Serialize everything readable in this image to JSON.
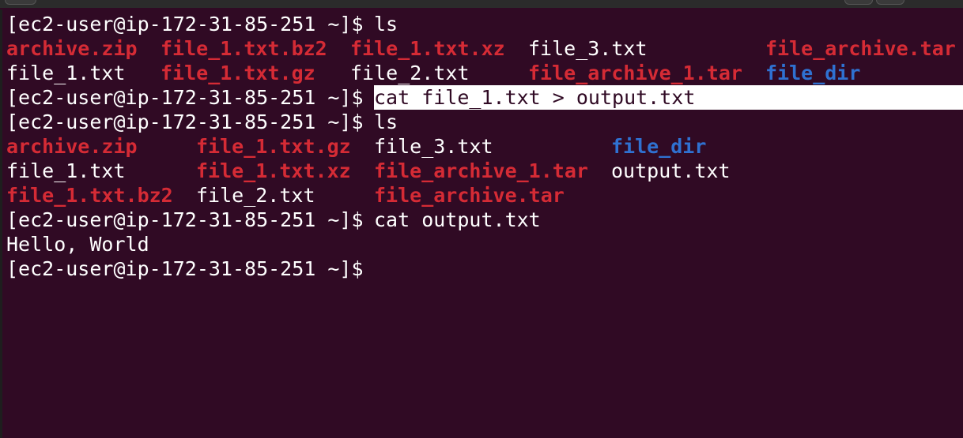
{
  "terminal": {
    "prompt": "[ec2-user@ip-172-31-85-251 ~]$",
    "commands": {
      "ls_1": "ls",
      "cat_redirect": "cat file_1.txt > output.txt",
      "ls_2": "ls",
      "cat_output": "cat output.txt"
    },
    "ls_1_output": {
      "row1": [
        "archive.zip",
        "file_1.txt.bz2",
        "file_1.txt.xz",
        "file_3.txt",
        "file_archive.tar"
      ],
      "row2": [
        "file_1.txt",
        "file_1.txt.gz",
        "file_2.txt",
        "file_archive_1.tar",
        "file_dir"
      ]
    },
    "ls_2_output": {
      "row1": [
        "archive.zip",
        "file_1.txt.gz",
        "file_3.txt",
        "file_dir"
      ],
      "row2": [
        "file_1.txt",
        "file_1.txt.xz",
        "file_archive_1.tar",
        "output.txt"
      ],
      "row3": [
        "file_1.txt.bz2",
        "file_2.txt",
        "file_archive.tar"
      ]
    },
    "cat_result": "Hello, World",
    "colors": {
      "background": "#300a24",
      "archive": "#d52b35",
      "directory": "#2f71d1",
      "text": "#ffffff"
    }
  }
}
